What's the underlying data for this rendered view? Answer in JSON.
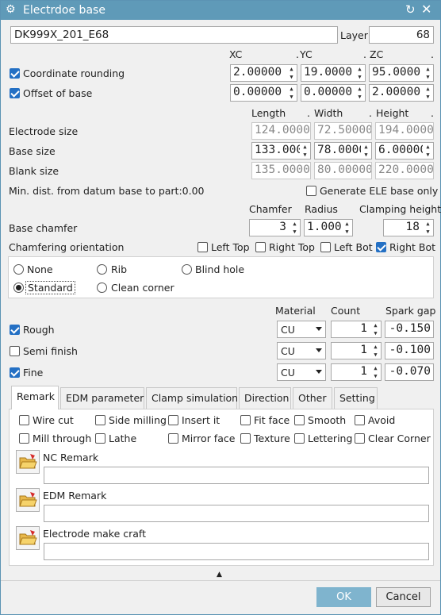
{
  "window": {
    "title": "Electrdoe base",
    "accent": "#5f9ab8"
  },
  "name_field": "DK999X_201_E68",
  "layer": {
    "label": "Layer",
    "value": "68"
  },
  "coord_headers": {
    "xc": "XC",
    "yc": "YC",
    "zc": "ZC",
    "dot": "."
  },
  "coordinate_rounding": {
    "label": "Coordinate rounding",
    "checked": true,
    "x": "2.00000",
    "y": "19.0000",
    "z": "95.0000"
  },
  "offset_of_base": {
    "label": "Offset of base",
    "checked": true,
    "x": "0.00000",
    "y": "0.00000",
    "z": "2.00000"
  },
  "size_headers": {
    "length": "Length",
    "width": "Width",
    "height": "Height",
    "dot": "."
  },
  "electrode_size": {
    "label": "Electrode size",
    "length": "124.0000",
    "width": "72.50000",
    "height": "194.0000"
  },
  "base_size": {
    "label": "Base size",
    "length": "133.000",
    "width": "78.0000",
    "height": "6.00000"
  },
  "blank_size": {
    "label": "Blank size",
    "length": "135.0000",
    "width": "80.00000",
    "height": "220.0000"
  },
  "min_dist": "Min. dist. from datum base to part:0.00",
  "generate_ele": {
    "label": "Generate ELE base only",
    "checked": false
  },
  "chamfer_headers": {
    "chamfer": "Chamfer",
    "radius": "Radius",
    "clamping": "Clamping height"
  },
  "base_chamfer": {
    "label": "Base chamfer",
    "chamfer": "3",
    "radius": "1.000",
    "clamping": "18"
  },
  "chamfer_orientation": {
    "label": "Chamfering orientation",
    "left_top": {
      "label": "Left Top",
      "checked": false
    },
    "right_top": {
      "label": "Right Top",
      "checked": false
    },
    "left_bot": {
      "label": "Left Bot",
      "checked": false
    },
    "right_bot": {
      "label": "Right Bot",
      "checked": true
    }
  },
  "base_type": {
    "none": "None",
    "rib": "Rib",
    "blind_hole": "Blind hole",
    "standard": "Standard",
    "clean_corner": "Clean corner",
    "selected": "standard"
  },
  "spark_headers": {
    "material": "Material",
    "count": "Count",
    "spark_gap": "Spark gap"
  },
  "spark_rows": [
    {
      "label": "Rough",
      "checked": true,
      "material": "CU",
      "count": "1",
      "gap": "-0.150"
    },
    {
      "label": "Semi finish",
      "checked": false,
      "material": "CU",
      "count": "1",
      "gap": "-0.100"
    },
    {
      "label": "Fine",
      "checked": true,
      "material": "CU",
      "count": "1",
      "gap": "-0.070"
    }
  ],
  "tabs": [
    "Remark",
    "EDM parameter",
    "Clamp simulation",
    "Direction",
    "Other",
    "Setting"
  ],
  "remark_options": {
    "wire_cut": "Wire cut",
    "side_milling": "Side milling",
    "insert_it": "Insert it",
    "fit_face": "Fit face",
    "smooth": "Smooth",
    "avoid": "Avoid",
    "mill_through": "Mill through",
    "lathe": "Lathe",
    "mirror_face": "Mirror face",
    "texture": "Texture",
    "lettering": "Lettering",
    "clear_corner": "Clear Corner"
  },
  "remarks": {
    "nc": "NC Remark",
    "edm": "EDM Remark",
    "craft": "Electrode make craft"
  },
  "buttons": {
    "ok": "OK",
    "cancel": "Cancel",
    "collapse": "▲"
  },
  "icons": {
    "settings": "⚙",
    "reset": "↻",
    "close": "✕",
    "spin_up": "▲",
    "spin_down": "▼"
  }
}
